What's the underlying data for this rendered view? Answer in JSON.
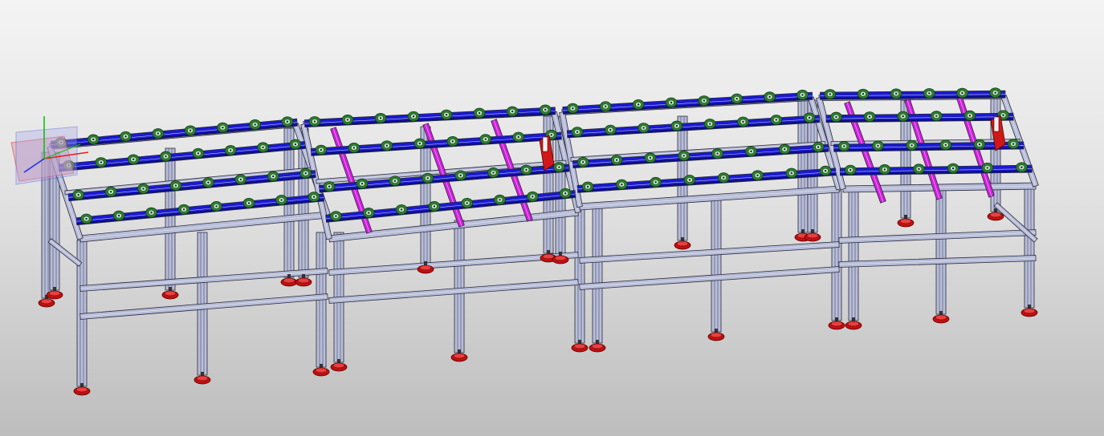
{
  "viewport": {
    "background_top": "#f4f4f4",
    "background_bottom": "#bdbdbd"
  },
  "model": {
    "name": "roller-conveyor-frame-assembly",
    "module_count": 4,
    "colors": {
      "frame_profile": "#b8bdd8",
      "frame_outline": "#2a2a3a",
      "roller_rail": "#1a1ad0",
      "roller_rail_dark": "#0d0d80",
      "roller": "#2e7d32",
      "roller_hub": "#c8e6c9",
      "diagonal_brace": "#d21ee0",
      "leveling_foot": "#c01010",
      "stopper": "#d01818"
    }
  },
  "triad": {
    "x_axis_color": "#e02020",
    "y_axis_color": "#10c010",
    "z_axis_color": "#2030e0",
    "plane_front_color": "#d8a0b0",
    "plane_side_color": "#a8a8e8"
  }
}
